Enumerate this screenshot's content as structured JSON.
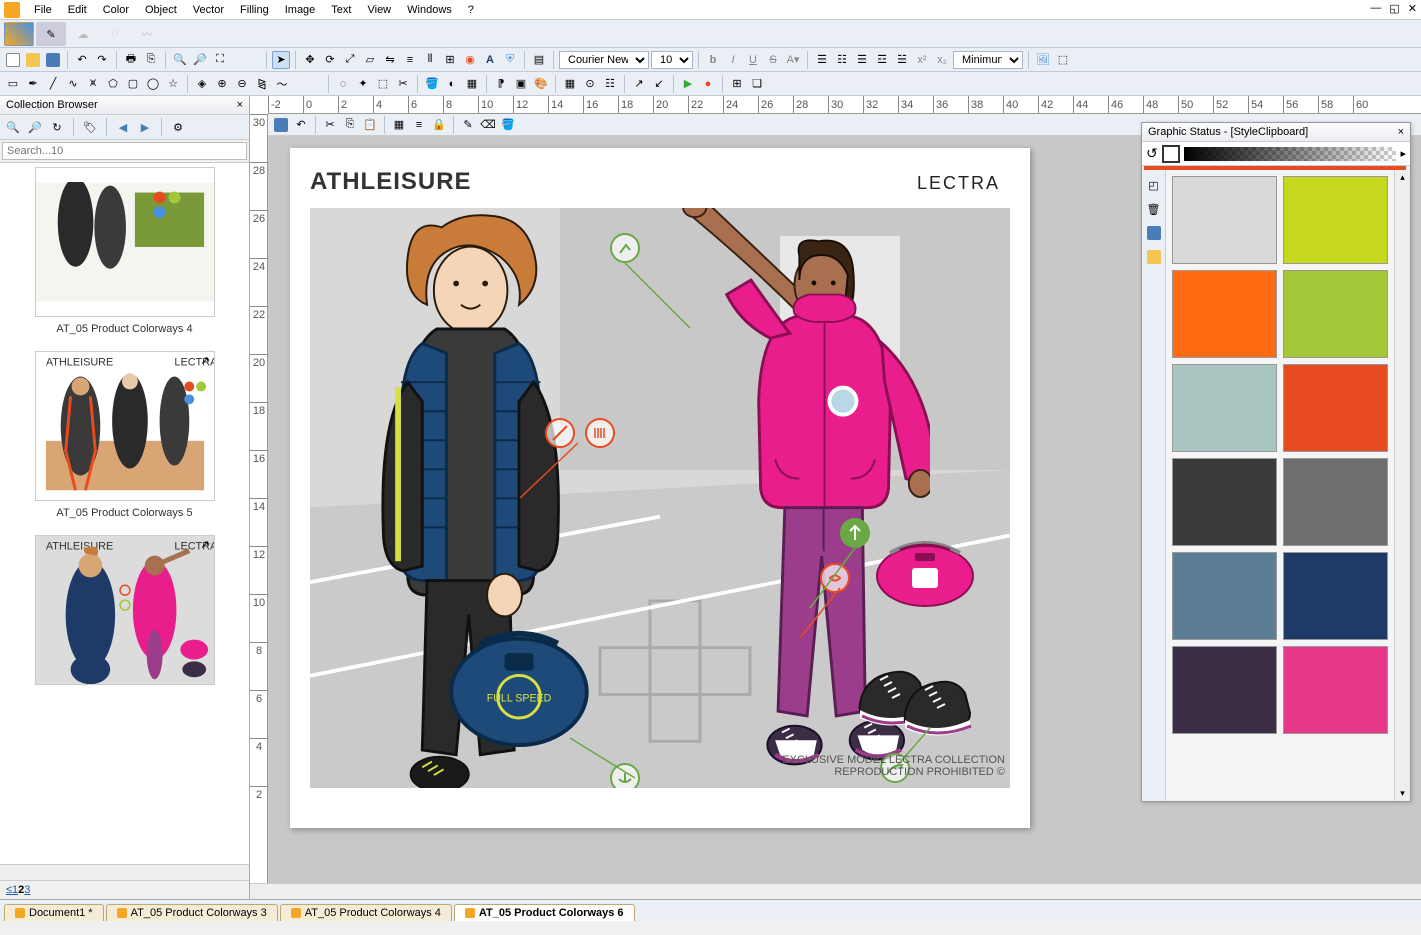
{
  "menu": {
    "items": [
      "File",
      "Edit",
      "Color",
      "Object",
      "Vector",
      "Filling",
      "Image",
      "Text",
      "View",
      "Windows",
      "?"
    ]
  },
  "text_toolbar": {
    "font": "Courier New",
    "size": "10",
    "style_dropdown": "Minimun"
  },
  "left_panel": {
    "title": "Collection Browser",
    "search_placeholder": "Search...10",
    "items": [
      {
        "label": "AT_05 Product Colorways 4"
      },
      {
        "label": "AT_05 Product Colorways 5"
      },
      {
        "label": ""
      }
    ],
    "pagination_prefix": "≤1",
    "pagination_current": "2",
    "pagination_rest": "3"
  },
  "artboard": {
    "title": "ATHLEISURE",
    "brand": "LECTRA",
    "footer_line1": "EXCLUSIVE MODEL LECTRA COLLECTION",
    "footer_line2": "REPRODUCTION PROHIBITED ©"
  },
  "thumb_labels": {
    "athleisure": "ATHLEISURE",
    "lectra": "LECTRA"
  },
  "right_panel": {
    "title": "Graphic Status - [StyleClipboard]",
    "swatches": [
      "#d9d9d9",
      "#c5d81e",
      "#ff6a13",
      "#a4c639",
      "#a9c5c1",
      "#e84b1f",
      "#3a3a3a",
      "#6e6e6e",
      "#5b7d95",
      "#1e3a66",
      "#3a2d45",
      "#e63888"
    ]
  },
  "ruler_h": [
    "-2",
    "0",
    "2",
    "4",
    "6",
    "8",
    "10",
    "12",
    "14",
    "16",
    "18",
    "20",
    "22",
    "24",
    "26",
    "28",
    "30",
    "32",
    "34",
    "36",
    "38",
    "40",
    "42",
    "44",
    "46",
    "48",
    "50",
    "52",
    "54",
    "56",
    "58",
    "60"
  ],
  "ruler_v": [
    "30",
    "28",
    "26",
    "24",
    "22",
    "20",
    "18",
    "16",
    "14",
    "12",
    "10",
    "8",
    "6",
    "4",
    "2"
  ],
  "doc_tabs": [
    {
      "label": "Document1 *",
      "active": false
    },
    {
      "label": "AT_05 Product Colorways 3",
      "active": false
    },
    {
      "label": "AT_05 Product Colorways 4",
      "active": false
    },
    {
      "label": "AT_05 Product Colorways 6",
      "active": true
    }
  ]
}
